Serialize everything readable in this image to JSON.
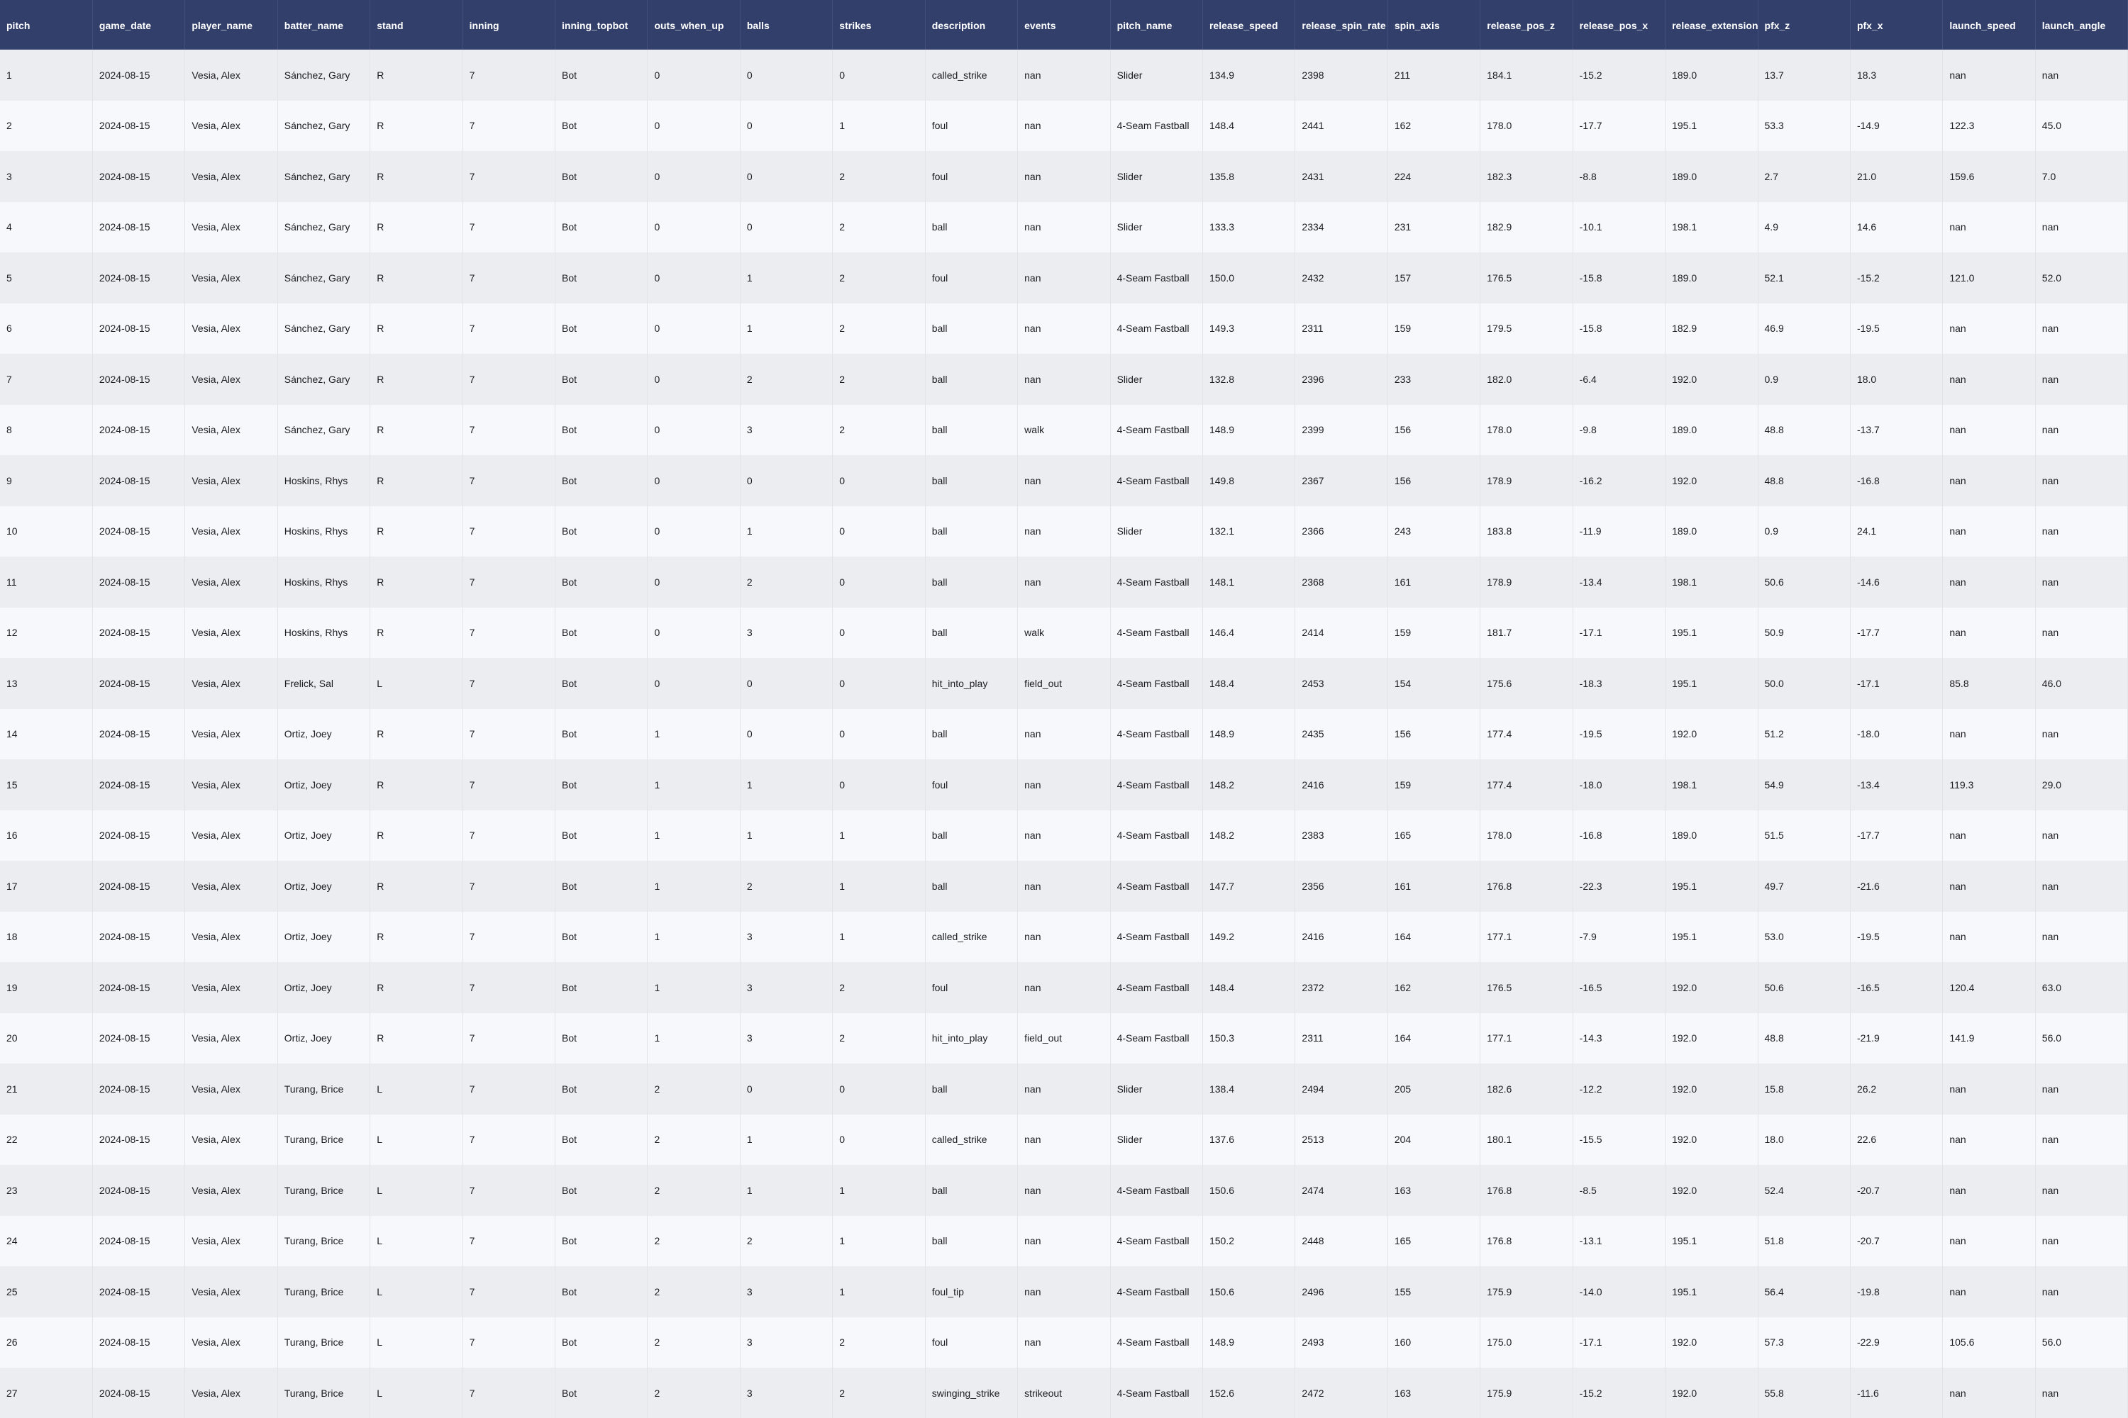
{
  "table": {
    "columns": [
      "pitch",
      "game_date",
      "player_name",
      "batter_name",
      "stand",
      "inning",
      "inning_topbot",
      "outs_when_up",
      "balls",
      "strikes",
      "description",
      "events",
      "pitch_name",
      "release_speed",
      "release_spin_rate",
      "spin_axis",
      "release_pos_z",
      "release_pos_x",
      "release_extension",
      "pfx_z",
      "pfx_x",
      "launch_speed",
      "launch_angle"
    ],
    "rows": [
      [
        "1",
        "2024-08-15",
        "Vesia, Alex",
        "Sánchez, Gary",
        "R",
        "7",
        "Bot",
        "0",
        "0",
        "0",
        "called_strike",
        "nan",
        "Slider",
        "134.9",
        "2398",
        "211",
        "184.1",
        "-15.2",
        "189.0",
        "13.7",
        "18.3",
        "nan",
        "nan"
      ],
      [
        "2",
        "2024-08-15",
        "Vesia, Alex",
        "Sánchez, Gary",
        "R",
        "7",
        "Bot",
        "0",
        "0",
        "1",
        "foul",
        "nan",
        "4-Seam Fastball",
        "148.4",
        "2441",
        "162",
        "178.0",
        "-17.7",
        "195.1",
        "53.3",
        "-14.9",
        "122.3",
        "45.0"
      ],
      [
        "3",
        "2024-08-15",
        "Vesia, Alex",
        "Sánchez, Gary",
        "R",
        "7",
        "Bot",
        "0",
        "0",
        "2",
        "foul",
        "nan",
        "Slider",
        "135.8",
        "2431",
        "224",
        "182.3",
        "-8.8",
        "189.0",
        "2.7",
        "21.0",
        "159.6",
        "7.0"
      ],
      [
        "4",
        "2024-08-15",
        "Vesia, Alex",
        "Sánchez, Gary",
        "R",
        "7",
        "Bot",
        "0",
        "0",
        "2",
        "ball",
        "nan",
        "Slider",
        "133.3",
        "2334",
        "231",
        "182.9",
        "-10.1",
        "198.1",
        "4.9",
        "14.6",
        "nan",
        "nan"
      ],
      [
        "5",
        "2024-08-15",
        "Vesia, Alex",
        "Sánchez, Gary",
        "R",
        "7",
        "Bot",
        "0",
        "1",
        "2",
        "foul",
        "nan",
        "4-Seam Fastball",
        "150.0",
        "2432",
        "157",
        "176.5",
        "-15.8",
        "189.0",
        "52.1",
        "-15.2",
        "121.0",
        "52.0"
      ],
      [
        "6",
        "2024-08-15",
        "Vesia, Alex",
        "Sánchez, Gary",
        "R",
        "7",
        "Bot",
        "0",
        "1",
        "2",
        "ball",
        "nan",
        "4-Seam Fastball",
        "149.3",
        "2311",
        "159",
        "179.5",
        "-15.8",
        "182.9",
        "46.9",
        "-19.5",
        "nan",
        "nan"
      ],
      [
        "7",
        "2024-08-15",
        "Vesia, Alex",
        "Sánchez, Gary",
        "R",
        "7",
        "Bot",
        "0",
        "2",
        "2",
        "ball",
        "nan",
        "Slider",
        "132.8",
        "2396",
        "233",
        "182.0",
        "-6.4",
        "192.0",
        "0.9",
        "18.0",
        "nan",
        "nan"
      ],
      [
        "8",
        "2024-08-15",
        "Vesia, Alex",
        "Sánchez, Gary",
        "R",
        "7",
        "Bot",
        "0",
        "3",
        "2",
        "ball",
        "walk",
        "4-Seam Fastball",
        "148.9",
        "2399",
        "156",
        "178.0",
        "-9.8",
        "189.0",
        "48.8",
        "-13.7",
        "nan",
        "nan"
      ],
      [
        "9",
        "2024-08-15",
        "Vesia, Alex",
        "Hoskins, Rhys",
        "R",
        "7",
        "Bot",
        "0",
        "0",
        "0",
        "ball",
        "nan",
        "4-Seam Fastball",
        "149.8",
        "2367",
        "156",
        "178.9",
        "-16.2",
        "192.0",
        "48.8",
        "-16.8",
        "nan",
        "nan"
      ],
      [
        "10",
        "2024-08-15",
        "Vesia, Alex",
        "Hoskins, Rhys",
        "R",
        "7",
        "Bot",
        "0",
        "1",
        "0",
        "ball",
        "nan",
        "Slider",
        "132.1",
        "2366",
        "243",
        "183.8",
        "-11.9",
        "189.0",
        "0.9",
        "24.1",
        "nan",
        "nan"
      ],
      [
        "11",
        "2024-08-15",
        "Vesia, Alex",
        "Hoskins, Rhys",
        "R",
        "7",
        "Bot",
        "0",
        "2",
        "0",
        "ball",
        "nan",
        "4-Seam Fastball",
        "148.1",
        "2368",
        "161",
        "178.9",
        "-13.4",
        "198.1",
        "50.6",
        "-14.6",
        "nan",
        "nan"
      ],
      [
        "12",
        "2024-08-15",
        "Vesia, Alex",
        "Hoskins, Rhys",
        "R",
        "7",
        "Bot",
        "0",
        "3",
        "0",
        "ball",
        "walk",
        "4-Seam Fastball",
        "146.4",
        "2414",
        "159",
        "181.7",
        "-17.1",
        "195.1",
        "50.9",
        "-17.7",
        "nan",
        "nan"
      ],
      [
        "13",
        "2024-08-15",
        "Vesia, Alex",
        "Frelick, Sal",
        "L",
        "7",
        "Bot",
        "0",
        "0",
        "0",
        "hit_into_play",
        "field_out",
        "4-Seam Fastball",
        "148.4",
        "2453",
        "154",
        "175.6",
        "-18.3",
        "195.1",
        "50.0",
        "-17.1",
        "85.8",
        "46.0"
      ],
      [
        "14",
        "2024-08-15",
        "Vesia, Alex",
        "Ortiz, Joey",
        "R",
        "7",
        "Bot",
        "1",
        "0",
        "0",
        "ball",
        "nan",
        "4-Seam Fastball",
        "148.9",
        "2435",
        "156",
        "177.4",
        "-19.5",
        "192.0",
        "51.2",
        "-18.0",
        "nan",
        "nan"
      ],
      [
        "15",
        "2024-08-15",
        "Vesia, Alex",
        "Ortiz, Joey",
        "R",
        "7",
        "Bot",
        "1",
        "1",
        "0",
        "foul",
        "nan",
        "4-Seam Fastball",
        "148.2",
        "2416",
        "159",
        "177.4",
        "-18.0",
        "198.1",
        "54.9",
        "-13.4",
        "119.3",
        "29.0"
      ],
      [
        "16",
        "2024-08-15",
        "Vesia, Alex",
        "Ortiz, Joey",
        "R",
        "7",
        "Bot",
        "1",
        "1",
        "1",
        "ball",
        "nan",
        "4-Seam Fastball",
        "148.2",
        "2383",
        "165",
        "178.0",
        "-16.8",
        "189.0",
        "51.5",
        "-17.7",
        "nan",
        "nan"
      ],
      [
        "17",
        "2024-08-15",
        "Vesia, Alex",
        "Ortiz, Joey",
        "R",
        "7",
        "Bot",
        "1",
        "2",
        "1",
        "ball",
        "nan",
        "4-Seam Fastball",
        "147.7",
        "2356",
        "161",
        "176.8",
        "-22.3",
        "195.1",
        "49.7",
        "-21.6",
        "nan",
        "nan"
      ],
      [
        "18",
        "2024-08-15",
        "Vesia, Alex",
        "Ortiz, Joey",
        "R",
        "7",
        "Bot",
        "1",
        "3",
        "1",
        "called_strike",
        "nan",
        "4-Seam Fastball",
        "149.2",
        "2416",
        "164",
        "177.1",
        "-7.9",
        "195.1",
        "53.0",
        "-19.5",
        "nan",
        "nan"
      ],
      [
        "19",
        "2024-08-15",
        "Vesia, Alex",
        "Ortiz, Joey",
        "R",
        "7",
        "Bot",
        "1",
        "3",
        "2",
        "foul",
        "nan",
        "4-Seam Fastball",
        "148.4",
        "2372",
        "162",
        "176.5",
        "-16.5",
        "192.0",
        "50.6",
        "-16.5",
        "120.4",
        "63.0"
      ],
      [
        "20",
        "2024-08-15",
        "Vesia, Alex",
        "Ortiz, Joey",
        "R",
        "7",
        "Bot",
        "1",
        "3",
        "2",
        "hit_into_play",
        "field_out",
        "4-Seam Fastball",
        "150.3",
        "2311",
        "164",
        "177.1",
        "-14.3",
        "192.0",
        "48.8",
        "-21.9",
        "141.9",
        "56.0"
      ],
      [
        "21",
        "2024-08-15",
        "Vesia, Alex",
        "Turang, Brice",
        "L",
        "7",
        "Bot",
        "2",
        "0",
        "0",
        "ball",
        "nan",
        "Slider",
        "138.4",
        "2494",
        "205",
        "182.6",
        "-12.2",
        "192.0",
        "15.8",
        "26.2",
        "nan",
        "nan"
      ],
      [
        "22",
        "2024-08-15",
        "Vesia, Alex",
        "Turang, Brice",
        "L",
        "7",
        "Bot",
        "2",
        "1",
        "0",
        "called_strike",
        "nan",
        "Slider",
        "137.6",
        "2513",
        "204",
        "180.1",
        "-15.5",
        "192.0",
        "18.0",
        "22.6",
        "nan",
        "nan"
      ],
      [
        "23",
        "2024-08-15",
        "Vesia, Alex",
        "Turang, Brice",
        "L",
        "7",
        "Bot",
        "2",
        "1",
        "1",
        "ball",
        "nan",
        "4-Seam Fastball",
        "150.6",
        "2474",
        "163",
        "176.8",
        "-8.5",
        "192.0",
        "52.4",
        "-20.7",
        "nan",
        "nan"
      ],
      [
        "24",
        "2024-08-15",
        "Vesia, Alex",
        "Turang, Brice",
        "L",
        "7",
        "Bot",
        "2",
        "2",
        "1",
        "ball",
        "nan",
        "4-Seam Fastball",
        "150.2",
        "2448",
        "165",
        "176.8",
        "-13.1",
        "195.1",
        "51.8",
        "-20.7",
        "nan",
        "nan"
      ],
      [
        "25",
        "2024-08-15",
        "Vesia, Alex",
        "Turang, Brice",
        "L",
        "7",
        "Bot",
        "2",
        "3",
        "1",
        "foul_tip",
        "nan",
        "4-Seam Fastball",
        "150.6",
        "2496",
        "155",
        "175.9",
        "-14.0",
        "195.1",
        "56.4",
        "-19.8",
        "nan",
        "nan"
      ],
      [
        "26",
        "2024-08-15",
        "Vesia, Alex",
        "Turang, Brice",
        "L",
        "7",
        "Bot",
        "2",
        "3",
        "2",
        "foul",
        "nan",
        "4-Seam Fastball",
        "148.9",
        "2493",
        "160",
        "175.0",
        "-17.1",
        "192.0",
        "57.3",
        "-22.9",
        "105.6",
        "56.0"
      ],
      [
        "27",
        "2024-08-15",
        "Vesia, Alex",
        "Turang, Brice",
        "L",
        "7",
        "Bot",
        "2",
        "3",
        "2",
        "swinging_strike",
        "strikeout",
        "4-Seam Fastball",
        "152.6",
        "2472",
        "163",
        "175.9",
        "-15.2",
        "192.0",
        "55.8",
        "-11.6",
        "nan",
        "nan"
      ]
    ]
  },
  "colors": {
    "header_bg": "#333f6b",
    "header_text": "#ffffff",
    "row_odd": "#ecedf1",
    "row_even": "#f7f8fc",
    "cell_text": "#1d1d1f"
  }
}
